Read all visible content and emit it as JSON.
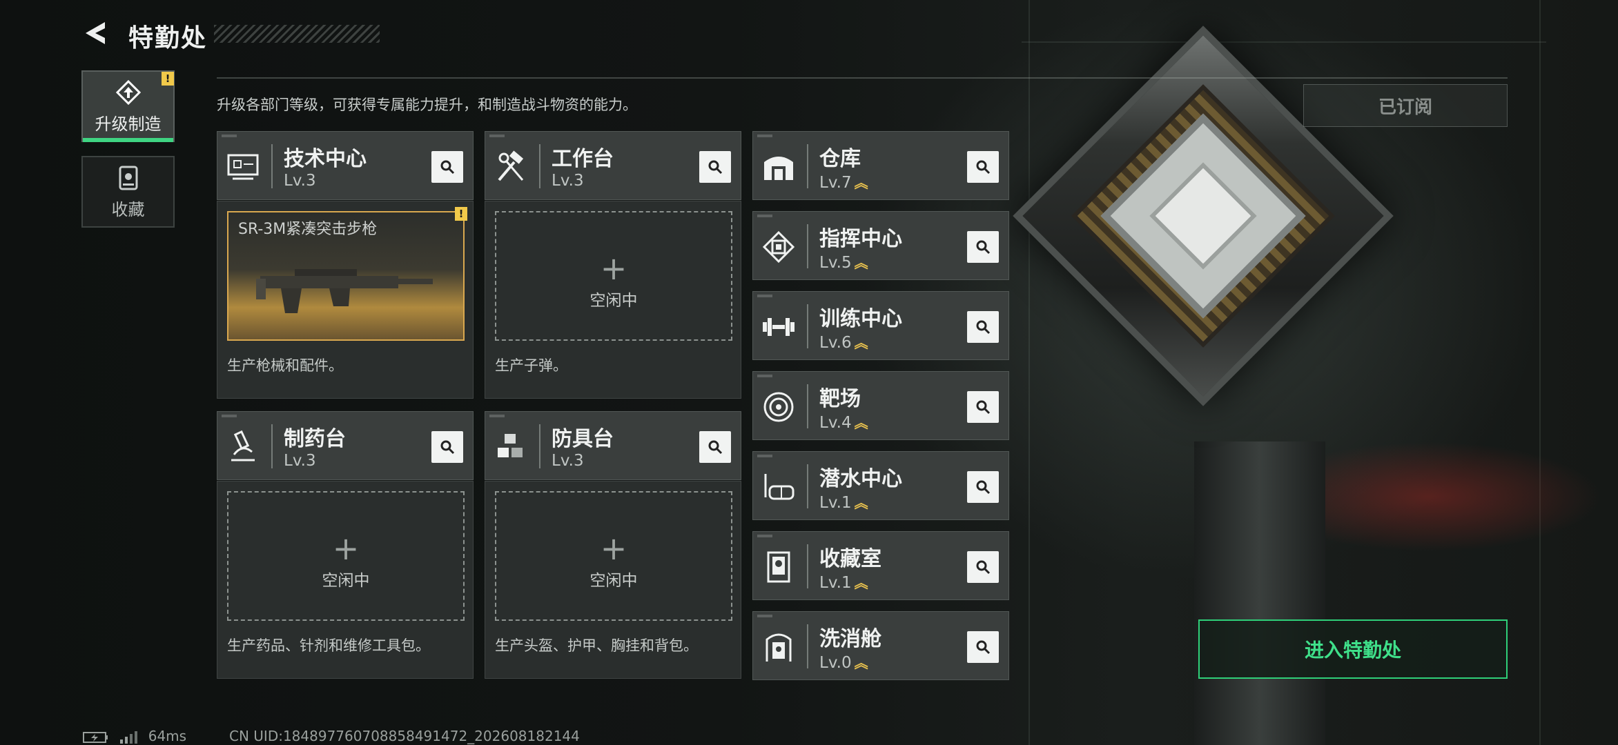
{
  "header": {
    "title": "特勤处"
  },
  "tabs": [
    {
      "label": "升级制造",
      "active": true,
      "icon": "upgrade-icon"
    },
    {
      "label": "收藏",
      "active": false,
      "icon": "collection-icon"
    }
  ],
  "description": "升级各部门等级，可获得专属能力提升，和制造战斗物资的能力。",
  "subscribed_label": "已订阅",
  "workshops": [
    {
      "name": "技术中心",
      "level": "Lv.3",
      "icon": "computer-icon",
      "slot": {
        "item": "SR-3M紧凑突击步枪",
        "has_alert": true
      },
      "description": "生产枪械和配件。"
    },
    {
      "name": "工作台",
      "level": "Lv.3",
      "icon": "tools-icon",
      "slot": {
        "status": "空闲中"
      },
      "description": "生产子弹。"
    },
    {
      "name": "制药台",
      "level": "Lv.3",
      "icon": "microscope-icon",
      "slot": {
        "status": "空闲中"
      },
      "description": "生产药品、针剂和维修工具包。"
    },
    {
      "name": "防具台",
      "level": "Lv.3",
      "icon": "cubes-icon",
      "slot": {
        "status": "空闲中"
      },
      "description": "生产头盔、护甲、胸挂和背包。"
    }
  ],
  "departments": [
    {
      "name": "仓库",
      "level": "Lv.7",
      "upgradable": true,
      "icon": "warehouse-icon"
    },
    {
      "name": "指挥中心",
      "level": "Lv.5",
      "upgradable": true,
      "icon": "chip-icon"
    },
    {
      "name": "训练中心",
      "level": "Lv.6",
      "upgradable": true,
      "icon": "dumbbell-icon"
    },
    {
      "name": "靶场",
      "level": "Lv.4",
      "upgradable": true,
      "icon": "target-icon"
    },
    {
      "name": "潜水中心",
      "level": "Lv.1",
      "upgradable": true,
      "icon": "diving-mask-icon"
    },
    {
      "name": "收藏室",
      "level": "Lv.1",
      "upgradable": true,
      "icon": "display-case-icon"
    },
    {
      "name": "洗消舱",
      "level": "Lv.0",
      "upgradable": true,
      "icon": "decon-chamber-icon"
    }
  ],
  "level_up_glyph": "︽",
  "plus_glyph": "+",
  "alert_glyph": "!",
  "enter_button": "进入特勤处",
  "status_bar": {
    "ping": "64ms",
    "uid": "CN UID:184897760708858491472_202608182144"
  },
  "colors": {
    "accent_green": "#3fd482",
    "alert_yellow": "#f1c94a",
    "gold": "#e8c14e"
  }
}
